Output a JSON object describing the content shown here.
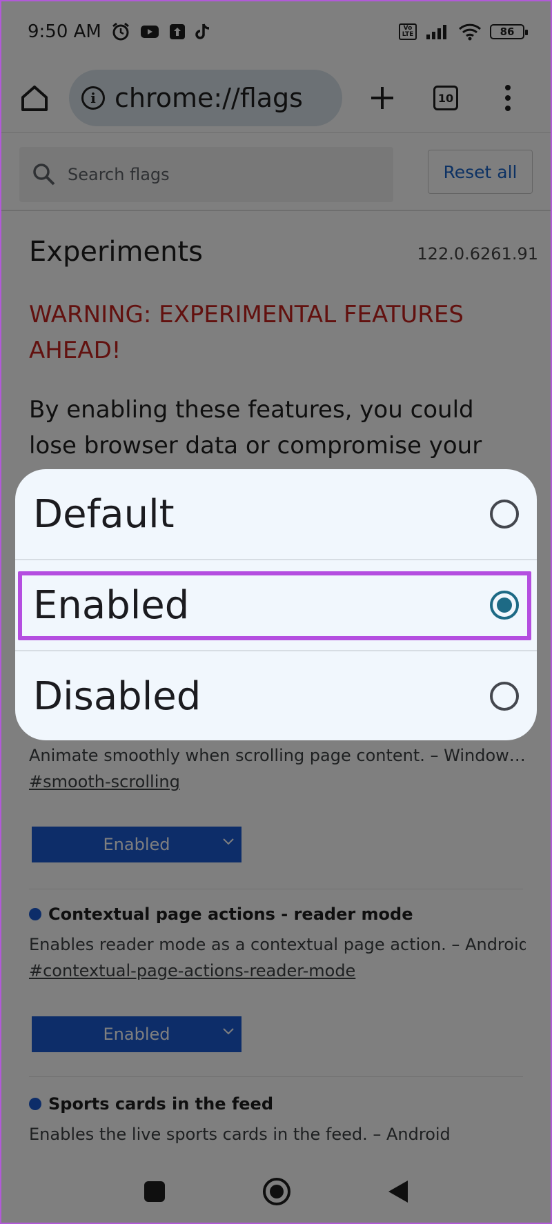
{
  "status_bar": {
    "time": "9:50 AM",
    "volte": "Vo LTE",
    "battery": "86"
  },
  "toolbar": {
    "url": "chrome://flags",
    "tab_count": "10"
  },
  "search": {
    "placeholder": "Search flags",
    "reset_label": "Reset all"
  },
  "header": {
    "title": "Experiments",
    "version": "122.0.6261.91",
    "warning": "WARNING: EXPERIMENTAL FEATURES AHEAD!",
    "warning_body": "By enabling these features, you could lose browser data or compromise your security"
  },
  "flags": [
    {
      "description": "Animate smoothly when scrolling page content. – Window…",
      "link": "#smooth-scrolling",
      "value": "Enabled"
    },
    {
      "title": "Contextual page actions - reader mode",
      "description": "Enables reader mode as a contextual page action. – Android",
      "link": "#contextual-page-actions-reader-mode",
      "value": "Enabled"
    },
    {
      "title": "Sports cards in the feed",
      "description": "Enables the live sports cards in the feed. – Android"
    }
  ],
  "dialog": {
    "options": [
      {
        "label": "Default",
        "selected": false
      },
      {
        "label": "Enabled",
        "selected": true
      },
      {
        "label": "Disabled",
        "selected": false
      }
    ]
  },
  "colors": {
    "accent_highlight": "#b44ee0",
    "radio_selected": "#1d6a85",
    "select_bg": "#1a5ad2",
    "warning": "#c5221f",
    "link": "#1a64c8"
  }
}
